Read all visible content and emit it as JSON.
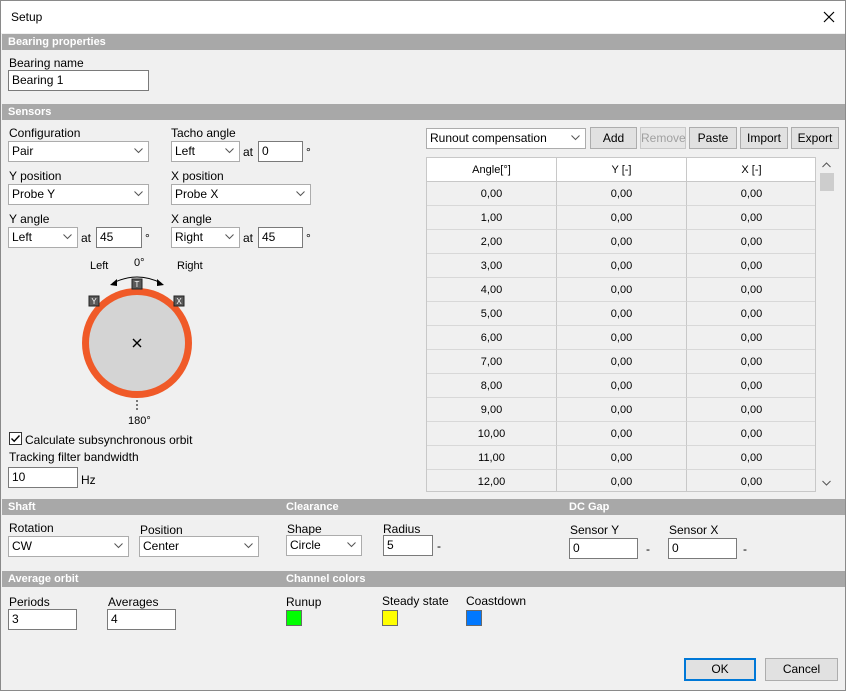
{
  "window": {
    "title": "Setup"
  },
  "sections": {
    "bearing": "Bearing properties",
    "sensors": "Sensors",
    "shaft": "Shaft",
    "clearance": "Clearance",
    "dcgap": "DC Gap",
    "average": "Average orbit",
    "colors": "Channel colors"
  },
  "bearing": {
    "name_label": "Bearing name",
    "name_value": "Bearing 1"
  },
  "sensors": {
    "configuration_label": "Configuration",
    "configuration_value": "Pair",
    "tacho_label": "Tacho angle",
    "tacho_side": "Left",
    "tacho_at": "at",
    "tacho_value": "0",
    "deg": "°",
    "y_position_label": "Y position",
    "y_position_value": "Probe Y",
    "x_position_label": "X position",
    "x_position_value": "Probe X",
    "y_angle_label": "Y angle",
    "y_angle_side": "Left",
    "y_angle_at": "at",
    "y_angle_value": "45",
    "x_angle_label": "X angle",
    "x_angle_side": "Right",
    "x_angle_at": "at",
    "x_angle_value": "45",
    "diagram": {
      "left": "Left",
      "right": "Right",
      "top": "0°",
      "bottom": "180°",
      "tacho_mark": "T",
      "y_mark": "Y",
      "x_mark": "X",
      "ring_color": "#f05a28",
      "disk_color": "#d4d4d4"
    },
    "subsync_label": "Calculate subsynchronous orbit",
    "subsync_checked": true,
    "bandwidth_label": "Tracking filter bandwidth",
    "bandwidth_value": "10",
    "bandwidth_unit": "Hz"
  },
  "runout": {
    "mode": "Runout compensation",
    "buttons": {
      "add": "Add",
      "remove": "Remove",
      "paste": "Paste",
      "import": "Import",
      "export": "Export"
    },
    "columns": [
      "Angle[°]",
      "Y [-]",
      "X [-]"
    ],
    "rows": [
      [
        "0,00",
        "0,00",
        "0,00"
      ],
      [
        "1,00",
        "0,00",
        "0,00"
      ],
      [
        "2,00",
        "0,00",
        "0,00"
      ],
      [
        "3,00",
        "0,00",
        "0,00"
      ],
      [
        "4,00",
        "0,00",
        "0,00"
      ],
      [
        "5,00",
        "0,00",
        "0,00"
      ],
      [
        "6,00",
        "0,00",
        "0,00"
      ],
      [
        "7,00",
        "0,00",
        "0,00"
      ],
      [
        "8,00",
        "0,00",
        "0,00"
      ],
      [
        "9,00",
        "0,00",
        "0,00"
      ],
      [
        "10,00",
        "0,00",
        "0,00"
      ],
      [
        "11,00",
        "0,00",
        "0,00"
      ],
      [
        "12,00",
        "0,00",
        "0,00"
      ]
    ]
  },
  "shaft": {
    "rotation_label": "Rotation",
    "rotation_value": "CW",
    "position_label": "Position",
    "position_value": "Center"
  },
  "clearance": {
    "shape_label": "Shape",
    "shape_value": "Circle",
    "radius_label": "Radius",
    "radius_value": "5",
    "radius_unit": "-"
  },
  "dcgap": {
    "sensor_y_label": "Sensor Y",
    "sensor_y_value": "0",
    "sensor_y_unit": "-",
    "sensor_x_label": "Sensor X",
    "sensor_x_value": "0",
    "sensor_x_unit": "-"
  },
  "average": {
    "periods_label": "Periods",
    "periods_value": "3",
    "averages_label": "Averages",
    "averages_value": "4"
  },
  "colors": {
    "runup_label": "Runup",
    "runup_color": "#00ff00",
    "steady_label": "Steady state",
    "steady_color": "#ffff00",
    "coastdown_label": "Coastdown",
    "coastdown_color": "#0078ff"
  },
  "footer": {
    "ok": "OK",
    "cancel": "Cancel"
  }
}
